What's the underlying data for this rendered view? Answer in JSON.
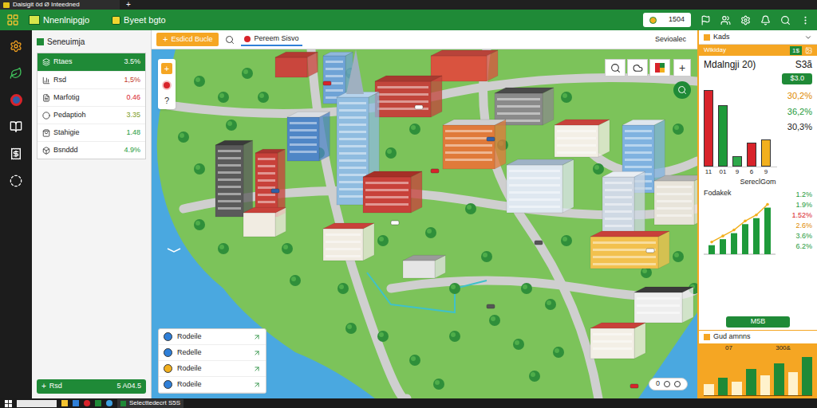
{
  "window": {
    "tab_title": "Daisigit öd Ø Inteedned",
    "new_tab": "+"
  },
  "toolbar": {
    "app_name": "Nnenlnipgjo",
    "project": "Byeet bgto",
    "counter": "1504"
  },
  "left_panel": {
    "title": "Seneuimja",
    "items": [
      {
        "label": "Rtaes",
        "value": "3.5%",
        "selected": true,
        "color": "#ffffff"
      },
      {
        "label": "Rsd",
        "value": "1,5%",
        "selected": false,
        "color": "#c0392b"
      },
      {
        "label": "Marfotig",
        "value": "0.46",
        "selected": false,
        "color": "#d8232a"
      },
      {
        "label": "Pedaptioh",
        "value": "3.35",
        "selected": false,
        "color": "#7a9a1a"
      },
      {
        "label": "Stahigie",
        "value": "1.48",
        "selected": false,
        "color": "#1e9a3a"
      },
      {
        "label": "Bsnddd",
        "value": "4.9%",
        "selected": false,
        "color": "#1e9a3a"
      }
    ],
    "footer": {
      "icon": "+",
      "label": "Rsd",
      "value": "5 A04.5"
    }
  },
  "map_header": {
    "add_icon": "+",
    "add_label": "Esdicd Bucle",
    "tab": "Pereem Sisvo",
    "right_label": "Sevioalec"
  },
  "map_controls": {
    "add": "+",
    "help": "?",
    "zoom_in": "+"
  },
  "layers": [
    {
      "label": "Rodeile",
      "color": "#2f7fd8"
    },
    {
      "label": "Redelle",
      "color": "#2f7fd8"
    },
    {
      "label": "Rodeile",
      "color": "#f2b01e"
    },
    {
      "label": "Rodeile",
      "color": "#2f7fd8"
    }
  ],
  "map_toggle": {
    "label": "0"
  },
  "right_panel": {
    "title": "Kads",
    "strip": {
      "label": "Wikiday",
      "badge": "1$"
    },
    "heading": "Mdalngji 20)",
    "amount": "S3ã",
    "button": "$3.0",
    "bars": [
      {
        "value": 90,
        "label": "11",
        "color": "#d8232a"
      },
      {
        "value": 72,
        "label": "01",
        "color": "#1e9a3a"
      },
      {
        "value": 12,
        "label": "9",
        "color": "#2ea84a"
      },
      {
        "value": 28,
        "label": "6",
        "color": "#d8232a"
      },
      {
        "value": 32,
        "label": "9",
        "color": "#f2b01e"
      }
    ],
    "percentages": [
      {
        "text": "30,2%",
        "color": "#e08a00"
      },
      {
        "text": "36,2%",
        "color": "#1e9a3a"
      },
      {
        "text": "30,3%",
        "color": "#222222"
      }
    ],
    "section_title": "SereclGom",
    "line_chart": {
      "title": "Fodakek",
      "values": [
        12,
        20,
        28,
        40,
        48,
        62
      ],
      "readings": [
        {
          "text": "1.2%",
          "color": "#1e9a3a"
        },
        {
          "text": "1.9%",
          "color": "#1e9a3a"
        },
        {
          "text": "1.52%",
          "color": "#d8232a"
        },
        {
          "text": "2.6%",
          "color": "#e08a00"
        },
        {
          "text": "3.6%",
          "color": "#1e9a3a"
        },
        {
          "text": "6.2%",
          "color": "#1e9a3a"
        }
      ]
    },
    "action_button": "M5B"
  },
  "bottom_panel": {
    "title": "Gud amnns",
    "labels": [
      "07",
      "300&"
    ],
    "values": [
      20,
      32,
      25,
      48,
      36,
      58,
      42,
      70
    ]
  },
  "taskbar": {
    "app": "Selecttedecrt S5S"
  }
}
